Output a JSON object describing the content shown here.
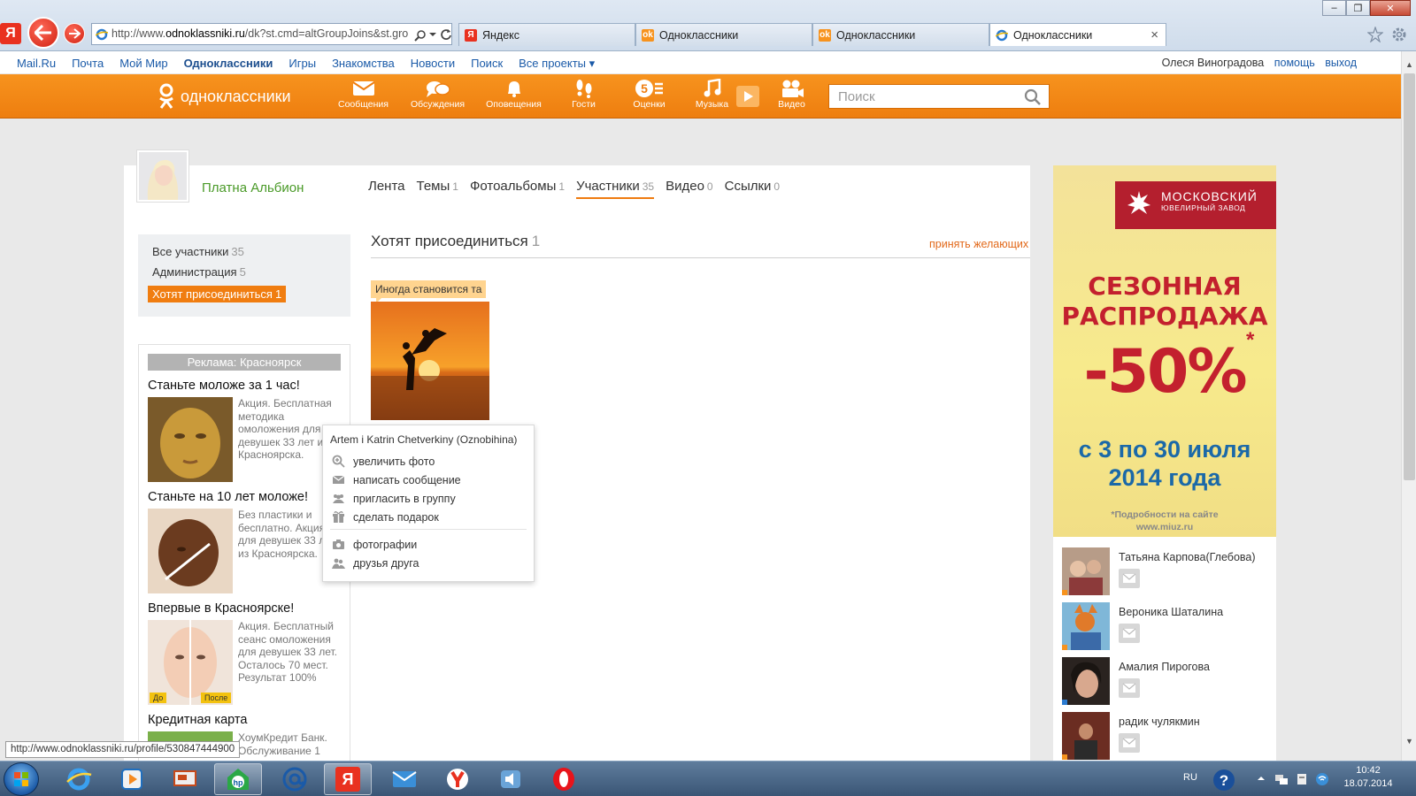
{
  "browser": {
    "address_prefix": "http://www.",
    "address_domain": "odnoklassniki.ru",
    "address_rest": "/dk?st.cmd=altGroupJoins&st.gro",
    "tabs": [
      {
        "label": "Яндекс",
        "icon": "yandex-icon"
      },
      {
        "label": "Одноклассники",
        "icon": "ok-icon"
      },
      {
        "label": "Одноклассники",
        "icon": "ok-icon"
      },
      {
        "label": "Одноклассники",
        "icon": "ie-icon",
        "close": "×"
      }
    ],
    "win_minimize": "–",
    "win_maximize": "❐",
    "win_close": "✕"
  },
  "portal": {
    "links": [
      "Mail.Ru",
      "Почта",
      "Мой Мир",
      "Одноклассники",
      "Игры",
      "Знакомства",
      "Новости",
      "Поиск",
      "Все проекты ▾"
    ],
    "user": "Олеся Виноградова",
    "help": "помощь",
    "logout": "выход"
  },
  "header": {
    "logo_text": "одноклассники",
    "nav": [
      "Сообщения",
      "Обсуждения",
      "Оповещения",
      "Гости",
      "Оценки",
      "Музыка",
      "Видео"
    ],
    "search_placeholder": "Поиск",
    "colors": {
      "orange": "#ee7e0f"
    }
  },
  "group": {
    "name": "Платна Альбион",
    "tabs": [
      {
        "label": "Лента",
        "count": ""
      },
      {
        "label": "Темы",
        "count": "1"
      },
      {
        "label": "Фотоальбомы",
        "count": "1"
      },
      {
        "label": "Участники",
        "count": "35"
      },
      {
        "label": "Видео",
        "count": "0"
      },
      {
        "label": "Ссылки",
        "count": "0"
      }
    ]
  },
  "leftnav": {
    "items": [
      {
        "label": "Все участники",
        "count": "35"
      },
      {
        "label": "Администрация",
        "count": "5"
      },
      {
        "label": "Хотят присоединиться",
        "count": "1"
      }
    ]
  },
  "ads": {
    "header": "Реклама: Красноярск",
    "items": [
      {
        "title": "Станьте моложе за 1 час!",
        "text": "Акция. Бесплатная методика омоложения для девушек 33 лет из Красноярска."
      },
      {
        "title": "Станьте на 10 лет моложе!",
        "text": "Без пластики и бесплатно. Акция для девушек 33 лет из Красноярска."
      },
      {
        "title": "Впервые в Красноярске!",
        "text": "Акция. Бесплатный сеанс омоложения для девушек 33 лет. Осталось 70 мест. Результат 100%",
        "badges": [
          "До",
          "После"
        ]
      },
      {
        "title": "Кредитная карта",
        "text": "ХоумКредит Банк. Обслуживание 1"
      }
    ]
  },
  "main": {
    "title": "Хотят присоединиться",
    "count": "1",
    "accept_link": "принять желающих",
    "member_caption": "Иногда становится та"
  },
  "popup": {
    "name": "Artem i Katrin Chetverkiny (Oznobihina)",
    "actions": [
      "увеличить фото",
      "написать сообщение",
      "пригласить в группу",
      "сделать подарок"
    ],
    "links": [
      "фотографии",
      "друзья друга"
    ]
  },
  "banner": {
    "brand_line1": "МОСКОВСКИЙ",
    "brand_line2": "ЮВЕЛИРНЫЙ ЗАВОД",
    "sale_line1": "СЕЗОННАЯ",
    "sale_line2": "РАСПРОДАЖА",
    "discount": "-50%",
    "asterisk": "*",
    "dates_line1": "с 3 по 30 июля",
    "dates_line2": "2014 года",
    "note_line1": "*Подробности на сайте",
    "note_line2": "www.miuz.ru"
  },
  "friends": [
    {
      "name": "Татьяна Карпова(Глебова)",
      "status_color": "#f7931e"
    },
    {
      "name": "Вероника Шаталина",
      "status_color": "#f7931e"
    },
    {
      "name": "Амалия Пирогова",
      "status_color": "#2b7bd0"
    },
    {
      "name": "радик чулякмин",
      "status_color": "#f7931e"
    }
  ],
  "status_url": "http://www.odnoklassniki.ru/profile/530847444900",
  "taskbar": {
    "lang": "RU",
    "time": "10:42",
    "date": "18.07.2014"
  }
}
